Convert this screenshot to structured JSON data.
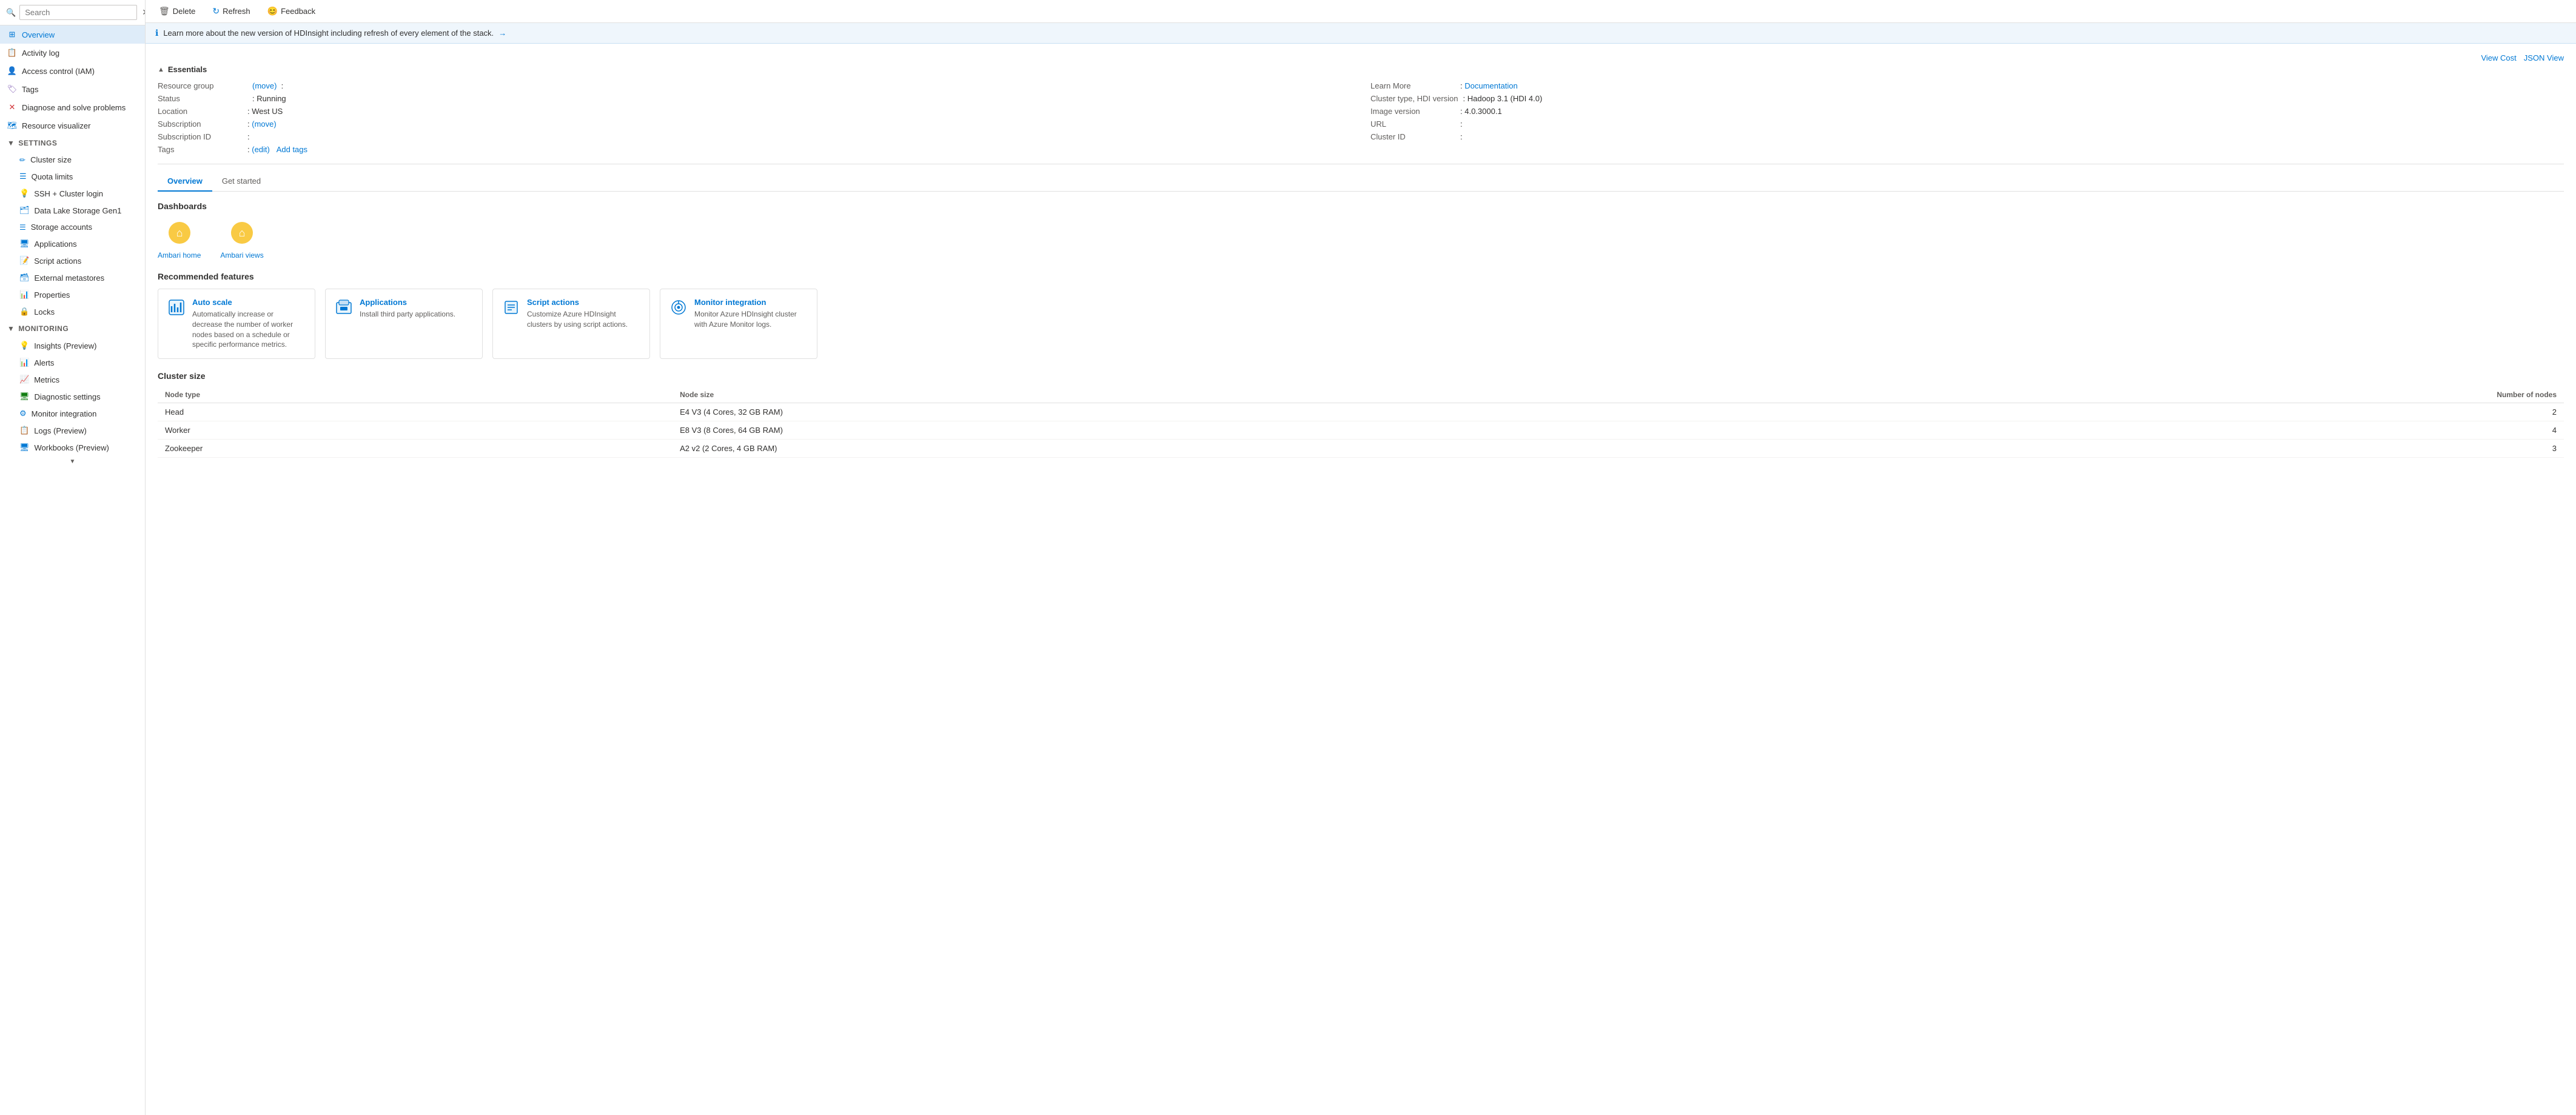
{
  "sidebar": {
    "search_placeholder": "Search",
    "collapse_label": "Collapse",
    "items": [
      {
        "id": "overview",
        "label": "Overview",
        "icon": "⊞",
        "active": true,
        "level": 0
      },
      {
        "id": "activity-log",
        "label": "Activity log",
        "icon": "📋",
        "active": false,
        "level": 0
      },
      {
        "id": "access-control",
        "label": "Access control (IAM)",
        "icon": "👤",
        "active": false,
        "level": 0
      },
      {
        "id": "tags",
        "label": "Tags",
        "icon": "🏷",
        "active": false,
        "level": 0
      },
      {
        "id": "diagnose",
        "label": "Diagnose and solve problems",
        "icon": "🔧",
        "active": false,
        "level": 0
      },
      {
        "id": "resource-visualizer",
        "label": "Resource visualizer",
        "icon": "🗺",
        "active": false,
        "level": 0
      }
    ],
    "settings_section": "Settings",
    "settings_items": [
      {
        "id": "cluster-size",
        "label": "Cluster size",
        "icon": "✏️"
      },
      {
        "id": "quota-limits",
        "label": "Quota limits",
        "icon": "📊"
      },
      {
        "id": "ssh-cluster-login",
        "label": "SSH + Cluster login",
        "icon": "💡"
      },
      {
        "id": "data-lake-storage",
        "label": "Data Lake Storage Gen1",
        "icon": "🗂"
      },
      {
        "id": "storage-accounts",
        "label": "Storage accounts",
        "icon": "☰"
      },
      {
        "id": "applications",
        "label": "Applications",
        "icon": "🖥"
      },
      {
        "id": "script-actions",
        "label": "Script actions",
        "icon": "📝"
      },
      {
        "id": "external-metastores",
        "label": "External metastores",
        "icon": "🗃"
      },
      {
        "id": "properties",
        "label": "Properties",
        "icon": "📊"
      },
      {
        "id": "locks",
        "label": "Locks",
        "icon": "🔒"
      }
    ],
    "monitoring_section": "Monitoring",
    "monitoring_items": [
      {
        "id": "insights",
        "label": "Insights (Preview)",
        "icon": "💡"
      },
      {
        "id": "alerts",
        "label": "Alerts",
        "icon": "🔔"
      },
      {
        "id": "metrics",
        "label": "Metrics",
        "icon": "📈"
      },
      {
        "id": "diagnostic-settings",
        "label": "Diagnostic settings",
        "icon": "🖥"
      },
      {
        "id": "monitor-integration",
        "label": "Monitor integration",
        "icon": "⚙"
      },
      {
        "id": "logs-preview",
        "label": "Logs (Preview)",
        "icon": "📋"
      },
      {
        "id": "workbooks-preview",
        "label": "Workbooks (Preview)",
        "icon": "🖥"
      }
    ]
  },
  "toolbar": {
    "delete_label": "Delete",
    "refresh_label": "Refresh",
    "feedback_label": "Feedback"
  },
  "banner": {
    "text": "Learn more about the new version of HDInsight including refresh of every element of the stack.",
    "arrow": "→"
  },
  "header_links": {
    "view_cost": "View Cost",
    "json_view": "JSON View"
  },
  "essentials": {
    "title": "Essentials",
    "left": [
      {
        "label": "Resource group",
        "value": "(move)  :",
        "has_link": true,
        "link_text": "move"
      },
      {
        "label": "Status",
        "value": "Running"
      },
      {
        "label": "Location",
        "value": "West US"
      },
      {
        "label": "Subscription",
        "value": "(move)",
        "has_link": true,
        "link_text": "move"
      },
      {
        "label": "Subscription ID",
        "value": ""
      },
      {
        "label": "Tags",
        "value": "(edit)",
        "add_tags": "Add tags",
        "has_link": true,
        "link_text": "edit"
      }
    ],
    "right": [
      {
        "label": "Learn More",
        "value": "Documentation",
        "has_link": true,
        "link_text": "Documentation"
      },
      {
        "label": "Cluster type, HDI version",
        "value": "Hadoop 3.1 (HDI 4.0)"
      },
      {
        "label": "Image version",
        "value": "4.0.3000.1"
      },
      {
        "label": "URL",
        "value": ""
      },
      {
        "label": "Cluster ID",
        "value": ""
      }
    ]
  },
  "tabs": [
    {
      "id": "overview-tab",
      "label": "Overview",
      "active": true
    },
    {
      "id": "get-started-tab",
      "label": "Get started",
      "active": false
    }
  ],
  "dashboards": {
    "title": "Dashboards",
    "items": [
      {
        "id": "ambari-home",
        "label": "Ambari home",
        "icon": "🔶"
      },
      {
        "id": "ambari-views",
        "label": "Ambari views",
        "icon": "🔶"
      }
    ]
  },
  "recommended": {
    "title": "Recommended features",
    "cards": [
      {
        "id": "auto-scale",
        "title": "Auto scale",
        "desc": "Automatically increase or decrease the number of worker nodes based on a schedule or specific performance metrics.",
        "icon": "📊"
      },
      {
        "id": "applications",
        "title": "Applications",
        "desc": "Install third party applications.",
        "icon": "🖥"
      },
      {
        "id": "script-actions",
        "title": "Script actions",
        "desc": "Customize Azure HDInsight clusters by using script actions.",
        "icon": "📝"
      },
      {
        "id": "monitor-integration",
        "title": "Monitor integration",
        "desc": "Monitor Azure HDInsight cluster with Azure Monitor logs.",
        "icon": "⚙"
      }
    ]
  },
  "cluster_size": {
    "title": "Cluster size",
    "columns": [
      "Node type",
      "Node size",
      "Number of nodes"
    ],
    "rows": [
      {
        "node_type": "Head",
        "node_size": "E4 V3 (4 Cores, 32 GB RAM)",
        "num_nodes": "2"
      },
      {
        "node_type": "Worker",
        "node_size": "E8 V3 (8 Cores, 64 GB RAM)",
        "num_nodes": "4"
      },
      {
        "node_type": "Zookeeper",
        "node_size": "A2 v2 (2 Cores, 4 GB RAM)",
        "num_nodes": "3"
      }
    ]
  }
}
